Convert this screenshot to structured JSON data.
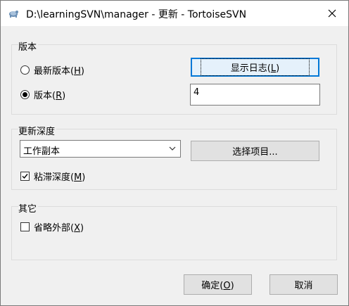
{
  "window": {
    "title": "D:\\learningSVN\\manager - 更新 - TortoiseSVN"
  },
  "revision_group": {
    "label": "版本",
    "head_radio": {
      "label": "最新版本(",
      "key": "H",
      "suffix": ")",
      "checked": false
    },
    "revision_radio": {
      "label": "版本(",
      "key": "R",
      "suffix": ")",
      "checked": true
    },
    "show_log_button": {
      "label": "显示日志(",
      "key": "L",
      "suffix": ")"
    },
    "revision_input_value": "4"
  },
  "depth_group": {
    "label": "更新深度",
    "depth_select": {
      "selected": "工作副本"
    },
    "choose_items_button": {
      "label": "选择项目..."
    },
    "sticky_depth": {
      "label": "粘滞深度(",
      "key": "M",
      "suffix": ")",
      "checked": true
    }
  },
  "other_group": {
    "label": "其它",
    "omit_externals": {
      "label": "省略外部(",
      "key": "X",
      "suffix": ")",
      "checked": false
    }
  },
  "footer": {
    "ok_button": {
      "label": "确定(",
      "key": "O",
      "suffix": ")"
    },
    "cancel_button": {
      "label": "取消"
    }
  },
  "colors": {
    "accent": "#0078d7",
    "dialog_bg": "#f0f0f0"
  }
}
